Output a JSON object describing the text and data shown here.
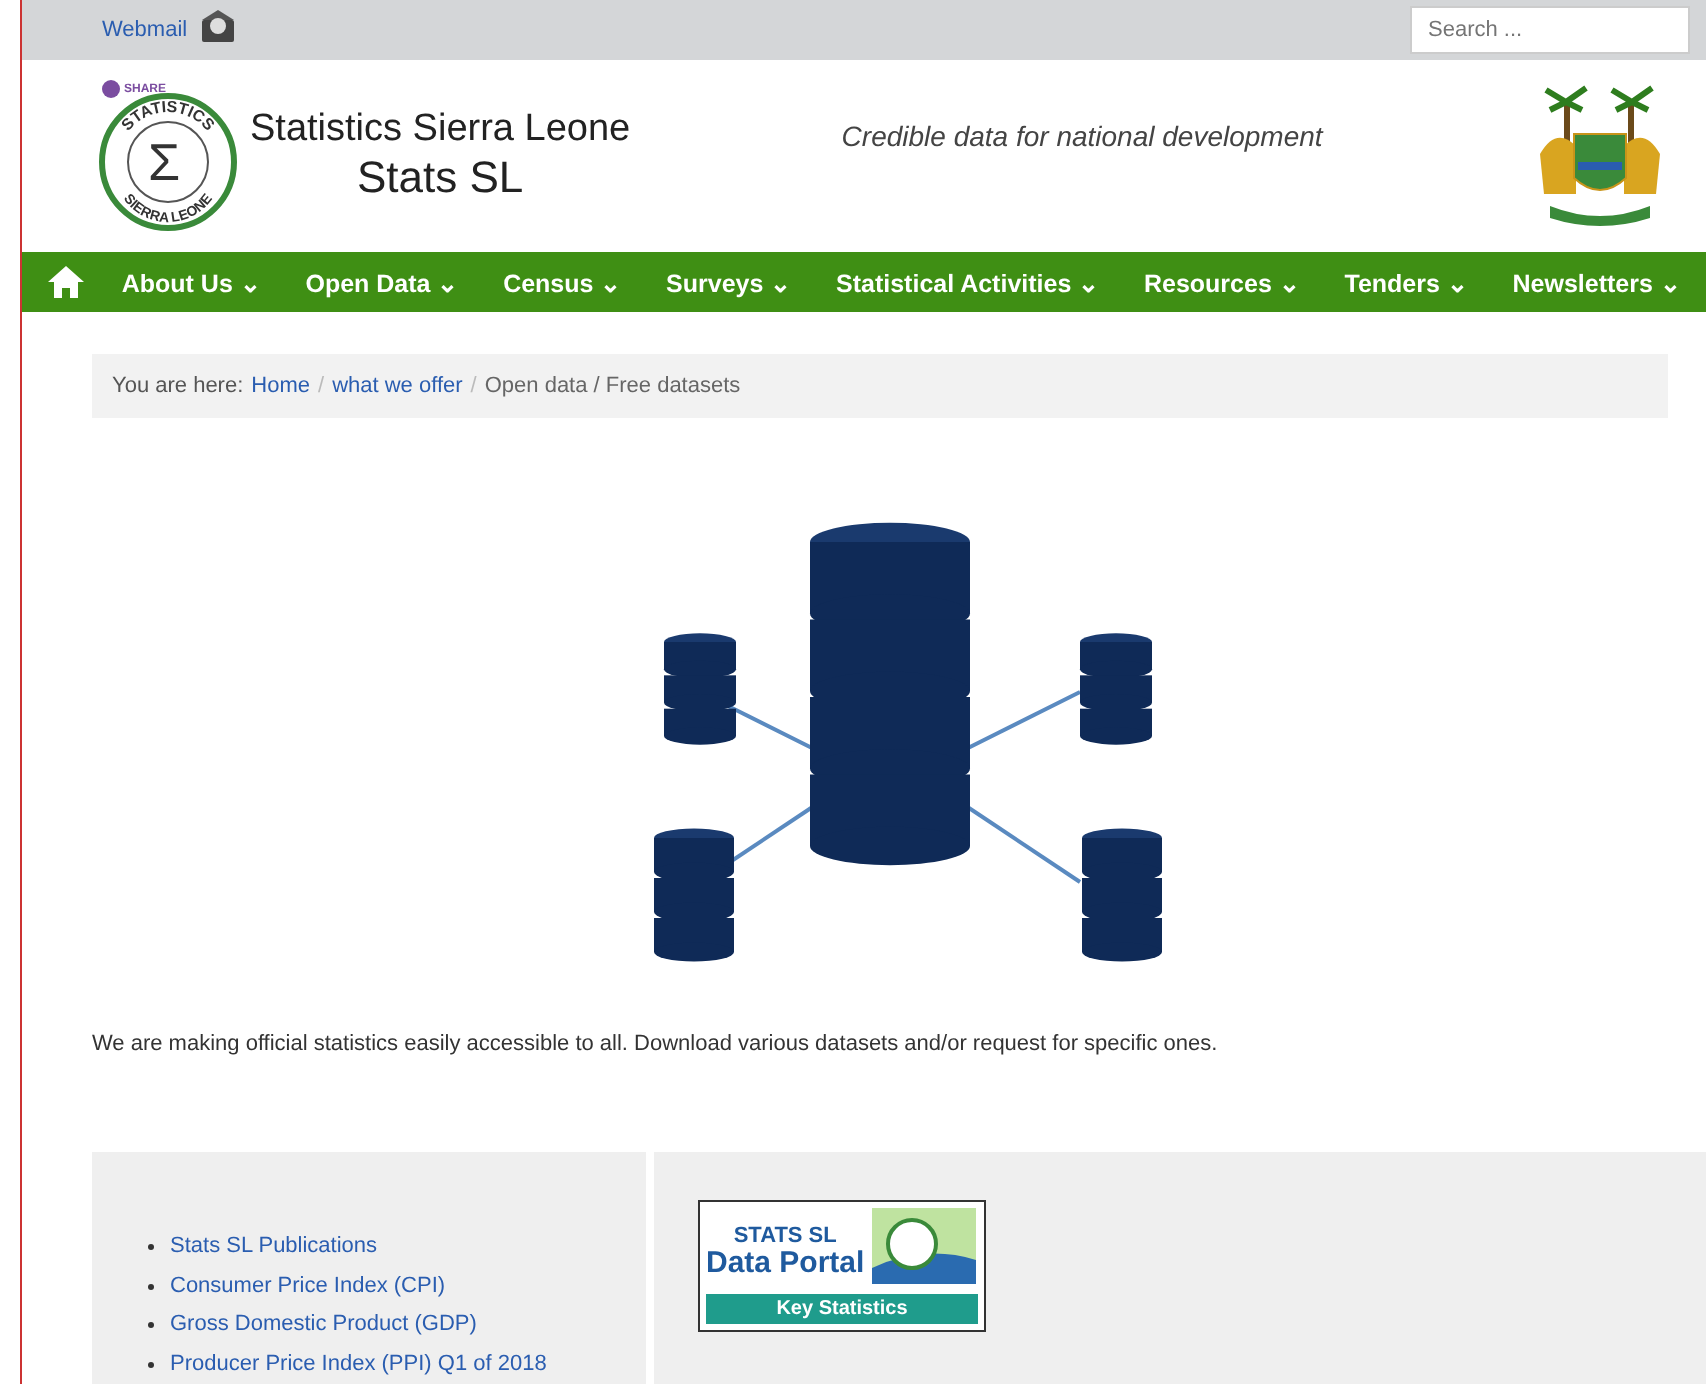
{
  "top_bar": {
    "webmail": "Webmail",
    "search": {
      "placeholder": "Search ..."
    }
  },
  "header": {
    "logo": {
      "share": "SHARE",
      "symbol": "Σ",
      "ring_top": "STATISTICS",
      "ring_bottom": "SIERRA LEONE"
    },
    "title": "Statistics Sierra Leone",
    "subtitle": "Stats SL",
    "tagline": "Credible data for national development"
  },
  "nav": {
    "items": [
      {
        "label": "About Us",
        "caret": "⌄"
      },
      {
        "label": "Open Data",
        "caret": "⌄"
      },
      {
        "label": "Census",
        "caret": "⌄"
      },
      {
        "label": "Surveys",
        "caret": "⌄"
      },
      {
        "label": "Statistical Activities",
        "caret": "⌄"
      },
      {
        "label": "Resources",
        "caret": "⌄"
      },
      {
        "label": "Tenders",
        "caret": "⌄"
      },
      {
        "label": "Newsletters",
        "caret": "⌄"
      }
    ]
  },
  "breadcrumb": {
    "prefix": "You are here:",
    "separator": "/",
    "items": [
      {
        "label": "Home",
        "kind": "link"
      },
      {
        "label": "what we offer",
        "kind": "link"
      },
      {
        "label": "Open data / Free datasets",
        "kind": "current"
      }
    ]
  },
  "intro": "We are making official statistics easily accessible to all. Download various datasets and/or request for specific ones.",
  "links": [
    {
      "label": "Stats SL Publications"
    },
    {
      "label": "Consumer Price Index (CPI)"
    },
    {
      "label": "Gross Domestic Product (GDP)"
    },
    {
      "label": "Producer Price Index (PPI) Q1 of 2018"
    }
  ],
  "portal_banner": {
    "line1": "STATS SL",
    "line2": "Data Portal",
    "button": "Key Statistics"
  }
}
